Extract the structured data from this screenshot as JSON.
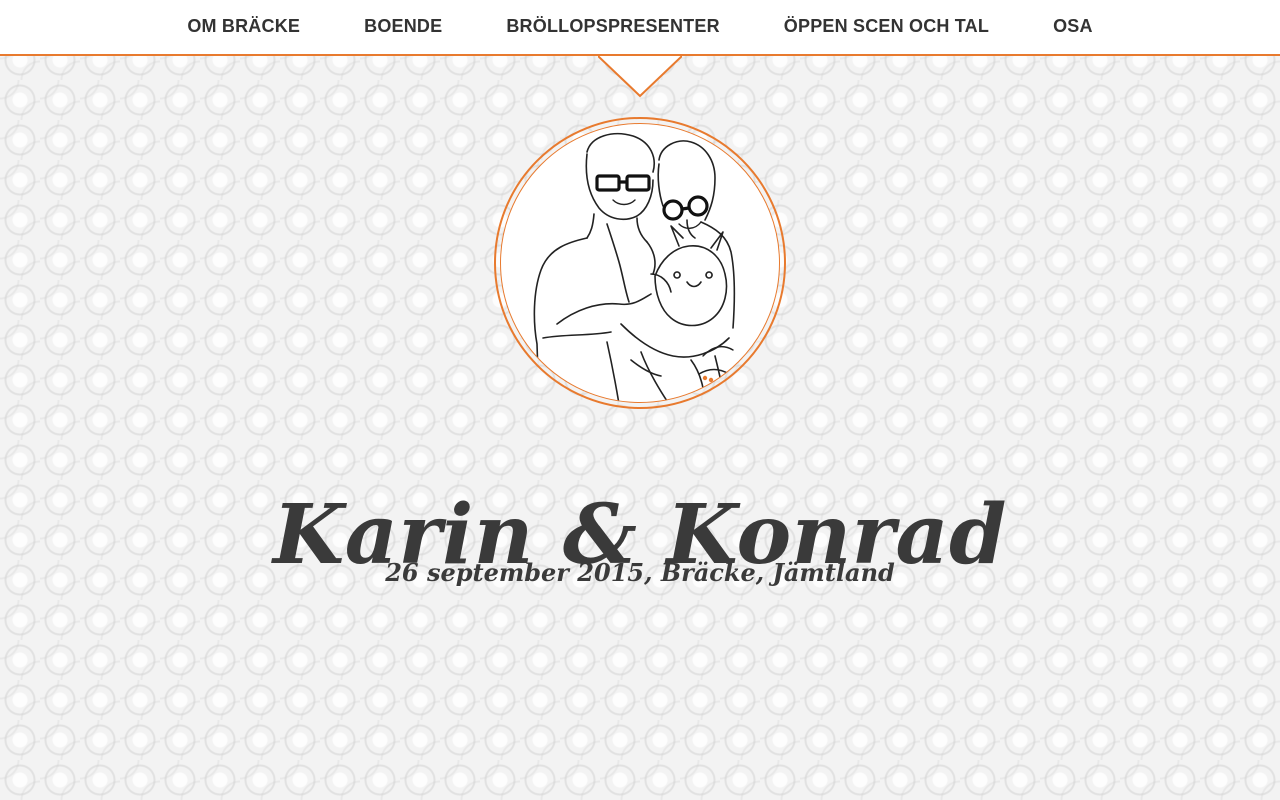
{
  "nav": {
    "items": [
      {
        "label": "OM BRÄCKE"
      },
      {
        "label": "BOENDE"
      },
      {
        "label": "BRÖLLOPSPRESENTER"
      },
      {
        "label": "ÖPPEN SCEN OCH TAL"
      },
      {
        "label": "OSA"
      }
    ]
  },
  "hero": {
    "title": "Karin & Konrad",
    "subtitle": "26 september 2015, Bräcke, Jämtland"
  },
  "colors": {
    "accent": "#e87a2e",
    "text": "#3a3a3a",
    "nav_bg": "#ffffff",
    "page_bg": "#f3f3f3"
  },
  "icons": {
    "portrait_image": "couple-with-dog-illustration"
  }
}
